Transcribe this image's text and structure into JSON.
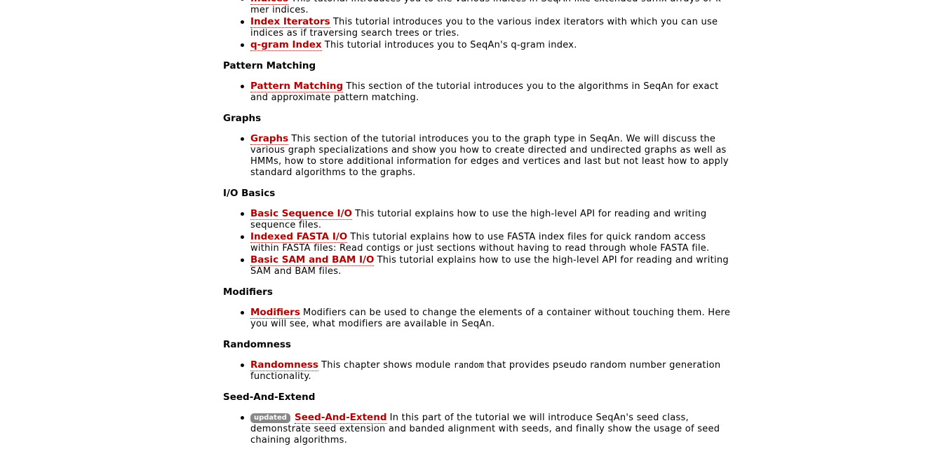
{
  "content": {
    "top_list": [
      {
        "title": "Indices",
        "before_code": "This tutorial introduces you to the various indices in SeqAn like extended suffix arrays or k-mer indices."
      },
      {
        "title": "Index Iterators",
        "before_code": "This tutorial introduces you to the various index iterators with which you can use indices as if traversing search trees or tries."
      },
      {
        "title": "q-gram Index",
        "before_code": "This tutorial introduces you to SeqAn's q-gram index."
      }
    ],
    "sections": [
      {
        "heading": "Pattern Matching",
        "items": [
          {
            "title": "Pattern Matching",
            "before_code": "This section of the tutorial introduces you to the algorithms in SeqAn for exact and approximate pattern matching."
          }
        ]
      },
      {
        "heading": "Graphs",
        "items": [
          {
            "title": "Graphs",
            "before_code": "This section of the tutorial introduces you to the graph type in SeqAn. We will discuss the various graph specializations and show you how to create directed and undirected graphs as well as HMMs, how to store additional information for edges and vertices and last but not least how to apply standard algorithms to the graphs."
          }
        ]
      },
      {
        "heading": "I/O Basics",
        "items": [
          {
            "title": "Basic Sequence I/O",
            "before_code": "This tutorial explains how to use the high-level API for reading and writing sequence files."
          },
          {
            "title": "Indexed FASTA I/O",
            "before_code": "This tutorial explains how to use FASTA index files for quick random access within FASTA files: Read contigs or just sections without having to read through whole FASTA file."
          },
          {
            "title": "Basic SAM and BAM I/O",
            "before_code": "This tutorial explains how to use the high-level API for reading and writing SAM and BAM files."
          }
        ]
      },
      {
        "heading": "Modifiers",
        "items": [
          {
            "title": "Modifiers",
            "before_code": "Modifiers can be used to change the elements of a container without touching them. Here you will see, what modifiers are available in SeqAn."
          }
        ]
      },
      {
        "heading": "Randomness",
        "items": [
          {
            "title": "Randomness",
            "before_code": "This chapter shows module",
            "code": "random",
            "after_code": "that provides pseudo random number generation functionality."
          }
        ]
      },
      {
        "heading": "Seed-And-Extend",
        "items": [
          {
            "badge": "updated",
            "title": "Seed-And-Extend",
            "before_code": "In this part of the tutorial we will introduce SeqAn's seed class, demonstrate seed extension and banded alignment with seeds, and finally show the usage of seed chaining algorithms."
          }
        ]
      }
    ]
  },
  "colors": {
    "link": "#b20000",
    "badge_bg": "#888888",
    "text": "#000000"
  }
}
